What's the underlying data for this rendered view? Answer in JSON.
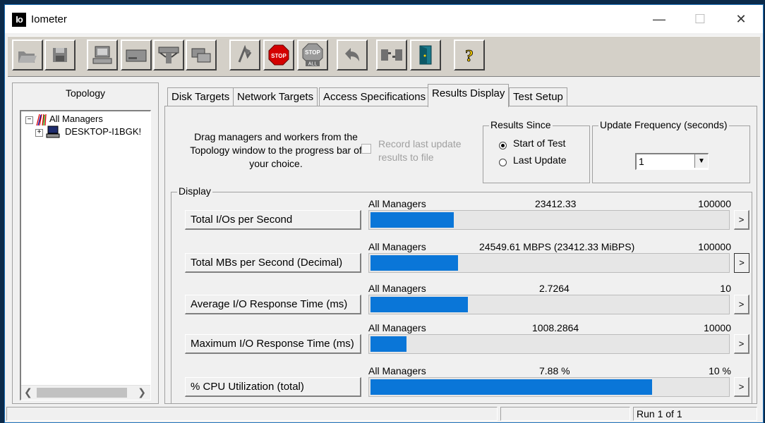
{
  "window": {
    "title": "Iometer",
    "icon_text": "Io"
  },
  "toolbar": {
    "buttons": [
      {
        "name": "open-config-button",
        "icon": "open-folder-icon"
      },
      {
        "name": "save-config-button",
        "icon": "floppy-disk-icon"
      },
      {
        "name": "start-new-manager-button",
        "icon": "computer-icon"
      },
      {
        "name": "start-disk-worker-button",
        "icon": "disk-drive-icon"
      },
      {
        "name": "start-network-worker-button",
        "icon": "network-icon"
      },
      {
        "name": "duplicate-worker-button",
        "icon": "duplicate-icon"
      },
      {
        "name": "start-tests-button",
        "icon": "green-flag-icon"
      },
      {
        "name": "stop-test-button",
        "icon": "stop-sign-icon",
        "label": "STOP"
      },
      {
        "name": "stop-all-button",
        "icon": "stop-all-icon",
        "label": "STOP",
        "sublabel": "ALL"
      },
      {
        "name": "reset-workers-button",
        "icon": "undo-arrow-icon"
      },
      {
        "name": "disconnect-managers-button",
        "icon": "disconnect-icon"
      },
      {
        "name": "exit-button",
        "icon": "exit-door-icon"
      },
      {
        "name": "about-button",
        "icon": "help-question-icon",
        "label": "?"
      }
    ]
  },
  "topology": {
    "header": "Topology",
    "root": "All Managers",
    "child": "DESKTOP-I1BGK!"
  },
  "tabs": [
    {
      "label": "Disk Targets"
    },
    {
      "label": "Network Targets"
    },
    {
      "label": "Access Specifications"
    },
    {
      "label": "Results Display"
    },
    {
      "label": "Test Setup"
    }
  ],
  "results": {
    "instructions": "Drag managers and workers from the Topology window to the progress bar of your choice.",
    "record_label": "Record last update results to file",
    "results_since": {
      "title": "Results Since",
      "option_start": "Start of Test",
      "option_last": "Last Update",
      "selected": "Start of Test"
    },
    "update_frequency": {
      "title": "Update Frequency (seconds)",
      "value": "1"
    },
    "display_title": "Display",
    "rows": [
      {
        "button": "Total I/Os per Second",
        "source": "All Managers",
        "value": "23412.33",
        "max": "100000",
        "fraction": 0.234
      },
      {
        "button": "Total MBs per Second (Decimal)",
        "source": "All Managers",
        "value": "24549.61 MBPS (23412.33 MiBPS)",
        "max": "100000",
        "fraction": 0.245
      },
      {
        "button": "Average I/O Response Time (ms)",
        "source": "All Managers",
        "value": "2.7264",
        "max": "10",
        "fraction": 0.273
      },
      {
        "button": "Maximum I/O Response Time (ms)",
        "source": "All Managers",
        "value": "1008.2864",
        "max": "10000",
        "fraction": 0.101
      },
      {
        "button": "% CPU Utilization (total)",
        "source": "All Managers",
        "value": "7.88 %",
        "max": "10 %",
        "fraction": 0.788
      }
    ],
    "more_label": ">"
  },
  "status": {
    "run": "Run 1 of 1"
  }
}
